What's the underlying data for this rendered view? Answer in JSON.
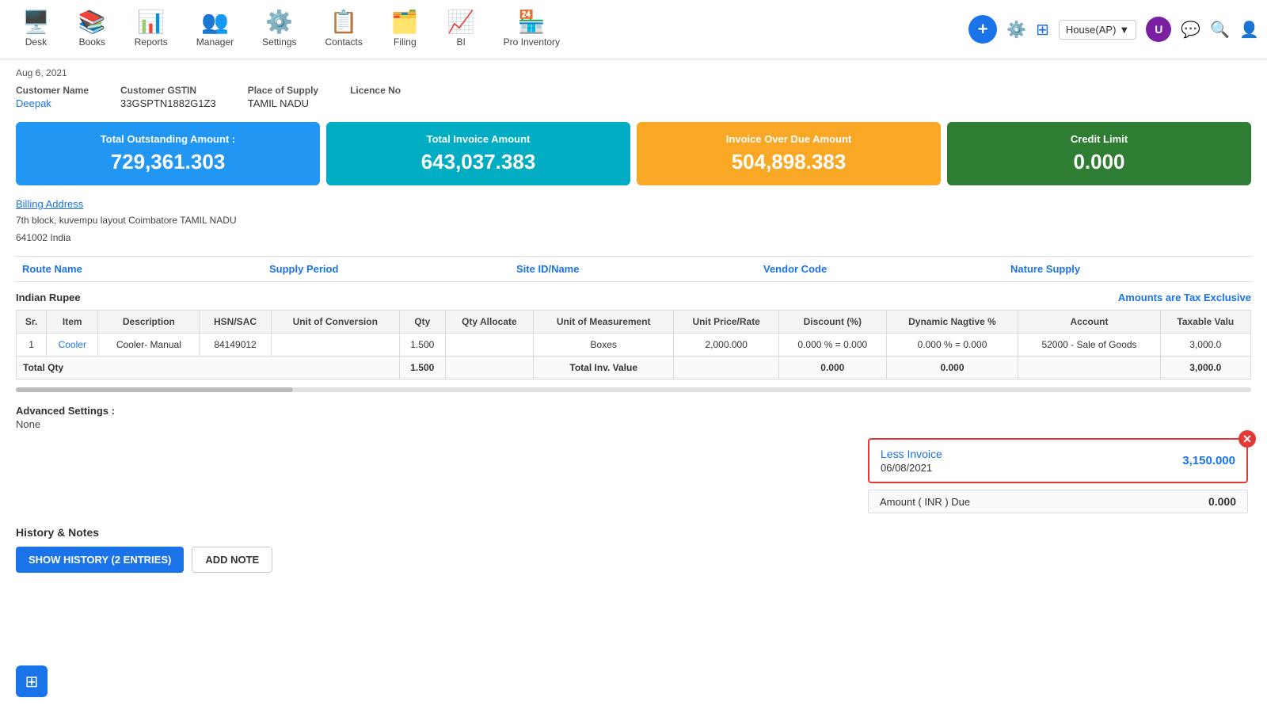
{
  "nav": {
    "items": [
      {
        "id": "desk",
        "label": "Desk",
        "icon": "🖥️"
      },
      {
        "id": "books",
        "label": "Books",
        "icon": "📚"
      },
      {
        "id": "reports",
        "label": "Reports",
        "icon": "📊"
      },
      {
        "id": "manager",
        "label": "Manager",
        "icon": "👥"
      },
      {
        "id": "settings",
        "label": "Settings",
        "icon": "⚙️"
      },
      {
        "id": "contacts",
        "label": "Contacts",
        "icon": "📋"
      },
      {
        "id": "filing",
        "label": "Filing",
        "icon": "🗂️"
      },
      {
        "id": "bi",
        "label": "BI",
        "icon": "📈"
      },
      {
        "id": "pro_inventory",
        "label": "Pro Inventory",
        "icon": "🏪"
      }
    ],
    "house": "House(AP)",
    "add_tooltip": "Add",
    "search_tooltip": "Search"
  },
  "page": {
    "date": "Aug 6, 2021"
  },
  "customer": {
    "name_label": "Customer Name",
    "name_value": "Deepak",
    "gstin_label": "Customer GSTIN",
    "gstin_value": "33GSPTN1882G1Z3",
    "supply_label": "Place of Supply",
    "supply_value": "TAMIL NADU",
    "licence_label": "Licence No",
    "licence_value": ""
  },
  "summary": {
    "outstanding_label": "Total Outstanding Amount :",
    "outstanding_value": "729,361.303",
    "invoice_label": "Total Invoice Amount",
    "invoice_value": "643,037.383",
    "overdue_label": "Invoice Over Due Amount",
    "overdue_value": "504,898.383",
    "credit_label": "Credit Limit",
    "credit_value": "0.000"
  },
  "billing": {
    "link_text": "Billing Address",
    "address_line1": "7th block, kuvempu layout Coimbatore TAMIL NADU",
    "address_line2": "641002 India"
  },
  "route": {
    "route_name": "Route Name",
    "supply_period": "Supply Period",
    "site_id": "Site ID/Name",
    "vendor_code": "Vendor Code",
    "nature_supply": "Nature Supply"
  },
  "table": {
    "currency": "Indian Rupee",
    "tax_note": "Amounts are Tax Exclusive",
    "columns": [
      "Sr.",
      "Item",
      "Description",
      "HSN/SAC",
      "Unit of Conversion",
      "Qty",
      "Qty Allocate",
      "Unit of Measurement",
      "Unit Price/Rate",
      "Discount (%)",
      "Dynamic Nagtive %",
      "Account",
      "Taxable Valu"
    ],
    "rows": [
      {
        "sr": "1",
        "item": "Cooler",
        "description": "Cooler- Manual",
        "hsn": "84149012",
        "unit_conversion": "",
        "qty": "1.500",
        "qty_allocate": "",
        "unit_measurement": "Boxes",
        "unit_price": "2,000.000",
        "discount": "0.000 % = 0.000",
        "dynamic": "0.000 % = 0.000",
        "account": "52000 - Sale of Goods",
        "taxable_value": "3,000.0"
      }
    ],
    "totals": {
      "total_qty_label": "Total Qty",
      "total_qty_value": "1.500",
      "total_inv_label": "Total Inv. Value",
      "total_inv_discount": "0.000",
      "total_inv_dynamic": "0.000",
      "total_inv_taxable": "3,000.0"
    }
  },
  "advanced": {
    "label": "Advanced Settings :",
    "value": "None"
  },
  "less_invoice": {
    "title_prefix": "Less",
    "title_link": "Invoice",
    "date": "06/08/2021",
    "amount": "3,150.000"
  },
  "amount_due": {
    "label": "Amount ( INR ) Due",
    "value": "0.000"
  },
  "history": {
    "title": "History & Notes",
    "show_history_btn": "SHOW HISTORY (2 ENTRIES)",
    "add_note_btn": "ADD NOTE"
  }
}
